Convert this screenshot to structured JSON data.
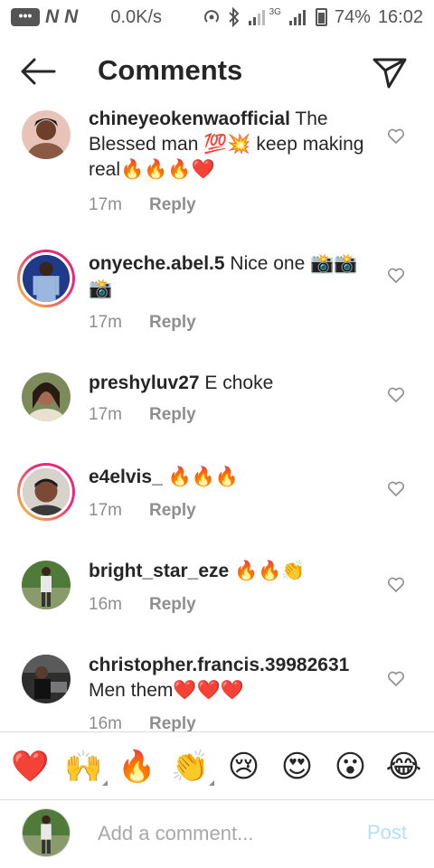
{
  "status_bar": {
    "chat_icon": "chat-bubble-icon",
    "app_letter_1": "N",
    "app_letter_2": "N",
    "speed": "0.0K/s",
    "network_type": "3G",
    "battery": "74%",
    "time": "16:02"
  },
  "header": {
    "title": "Comments",
    "back_icon": "back-arrow-icon",
    "share_icon": "paper-plane-icon"
  },
  "comments": [
    {
      "username": "chineyeokenwaofficial",
      "text": " The Blessed man 💯💥 keep making real🔥🔥🔥❤️",
      "time": "17m",
      "reply": "Reply"
    },
    {
      "username": "onyeche.abel.5",
      "text": " Nice one 📸📸📸",
      "time": "17m",
      "reply": "Reply"
    },
    {
      "username": "preshyluv27",
      "text": " E choke",
      "time": "17m",
      "reply": "Reply"
    },
    {
      "username": "e4elvis_",
      "text": " 🔥🔥🔥",
      "time": "17m",
      "reply": "Reply"
    },
    {
      "username": "bright_star_eze",
      "text": " 🔥🔥👏",
      "time": "16m",
      "reply": "Reply"
    },
    {
      "username": "christopher.francis.39982631",
      "text": " Men them❤️❤️❤️",
      "time": "16m",
      "reply": "Reply"
    }
  ],
  "reactions": [
    "❤️",
    "🙌",
    "🔥",
    "👏",
    "😢",
    "😍",
    "😮",
    "😂"
  ],
  "composer": {
    "placeholder": "Add a comment...",
    "post_label": "Post"
  },
  "colors": {
    "text": "#262626",
    "secondary": "#8e8e8e",
    "post_disabled": "#b2dffc",
    "story_ring_start": "#f9ce34",
    "story_ring_end": "#d62976"
  }
}
